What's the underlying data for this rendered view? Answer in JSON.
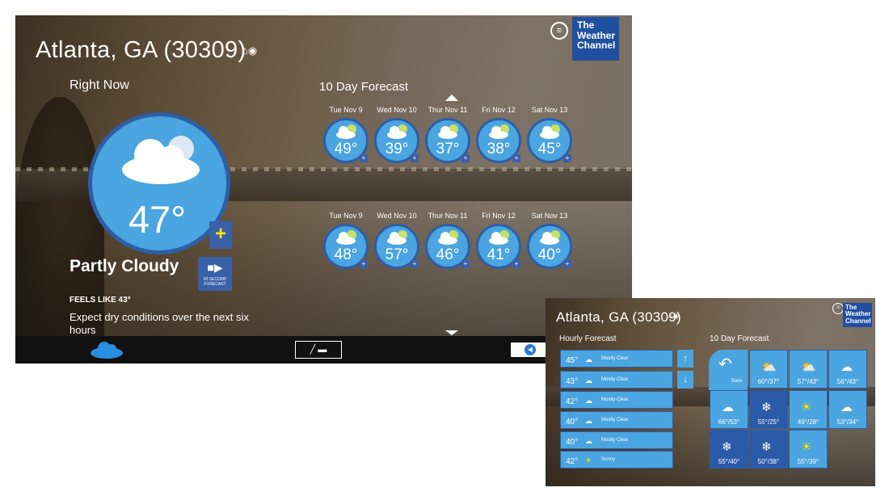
{
  "main": {
    "location": "Atlanta, GA (30309)",
    "right_now_label": "Right Now",
    "current_temp": "47°",
    "condition": "Partly Cloudy",
    "video_label": "60 SECOND FORECAST",
    "feels_like": "FEELS LIKE 43°",
    "description": "Expect dry conditions over the next six hours",
    "forecast_title": "10 Day Forecast",
    "row1": [
      {
        "day": "Tue Nov 9",
        "temp": "49°"
      },
      {
        "day": "Wed Nov 10",
        "temp": "39°"
      },
      {
        "day": "Thur Nov 11",
        "temp": "37°"
      },
      {
        "day": "Fri Nov 12",
        "temp": "38°"
      },
      {
        "day": "Sat Nov 13",
        "temp": "45°"
      }
    ],
    "row2": [
      {
        "day": "Tue Nov 9",
        "temp": "48°"
      },
      {
        "day": "Wed Nov 10",
        "temp": "57°"
      },
      {
        "day": "Thur Nov 11",
        "temp": "46°"
      },
      {
        "day": "Fri Nov 12",
        "temp": "41°"
      },
      {
        "day": "Sat Nov 13",
        "temp": "40°"
      }
    ],
    "logo": "The Weather Channel"
  },
  "second": {
    "location": "Atlanta, GA (30309)",
    "hourly_title": "Hourly Forecast",
    "forecast_title": "10 Day Forecast",
    "hourly": [
      {
        "temp": "45°",
        "cond": "Mostly Clear"
      },
      {
        "temp": "43°",
        "cond": "Mostly Clear"
      },
      {
        "temp": "42°",
        "cond": "Mostly Clear"
      },
      {
        "temp": "40°",
        "cond": "Mostly Clear"
      },
      {
        "temp": "40°",
        "cond": "Mostly Clear"
      },
      {
        "temp": "42°",
        "cond": "Sunny"
      }
    ],
    "back_label": "Back",
    "tiles": [
      {
        "temp": "60°/37°",
        "icon": "sun-cloud"
      },
      {
        "temp": "57°/43°",
        "icon": "sun-cloud"
      },
      {
        "temp": "56°/43°",
        "icon": "cloud"
      },
      {
        "temp": "66°/53°",
        "icon": "cloud"
      },
      {
        "temp": "55°/25°",
        "icon": "snow"
      },
      {
        "temp": "49°/28°",
        "icon": "sun"
      },
      {
        "temp": "53°/34°",
        "icon": "cloud"
      },
      {
        "temp": "55°/40°",
        "icon": "snow"
      },
      {
        "temp": "50°/38°",
        "icon": "snow"
      },
      {
        "temp": "55°/39°",
        "icon": "sun"
      }
    ],
    "logo": "The Weather Channel"
  }
}
